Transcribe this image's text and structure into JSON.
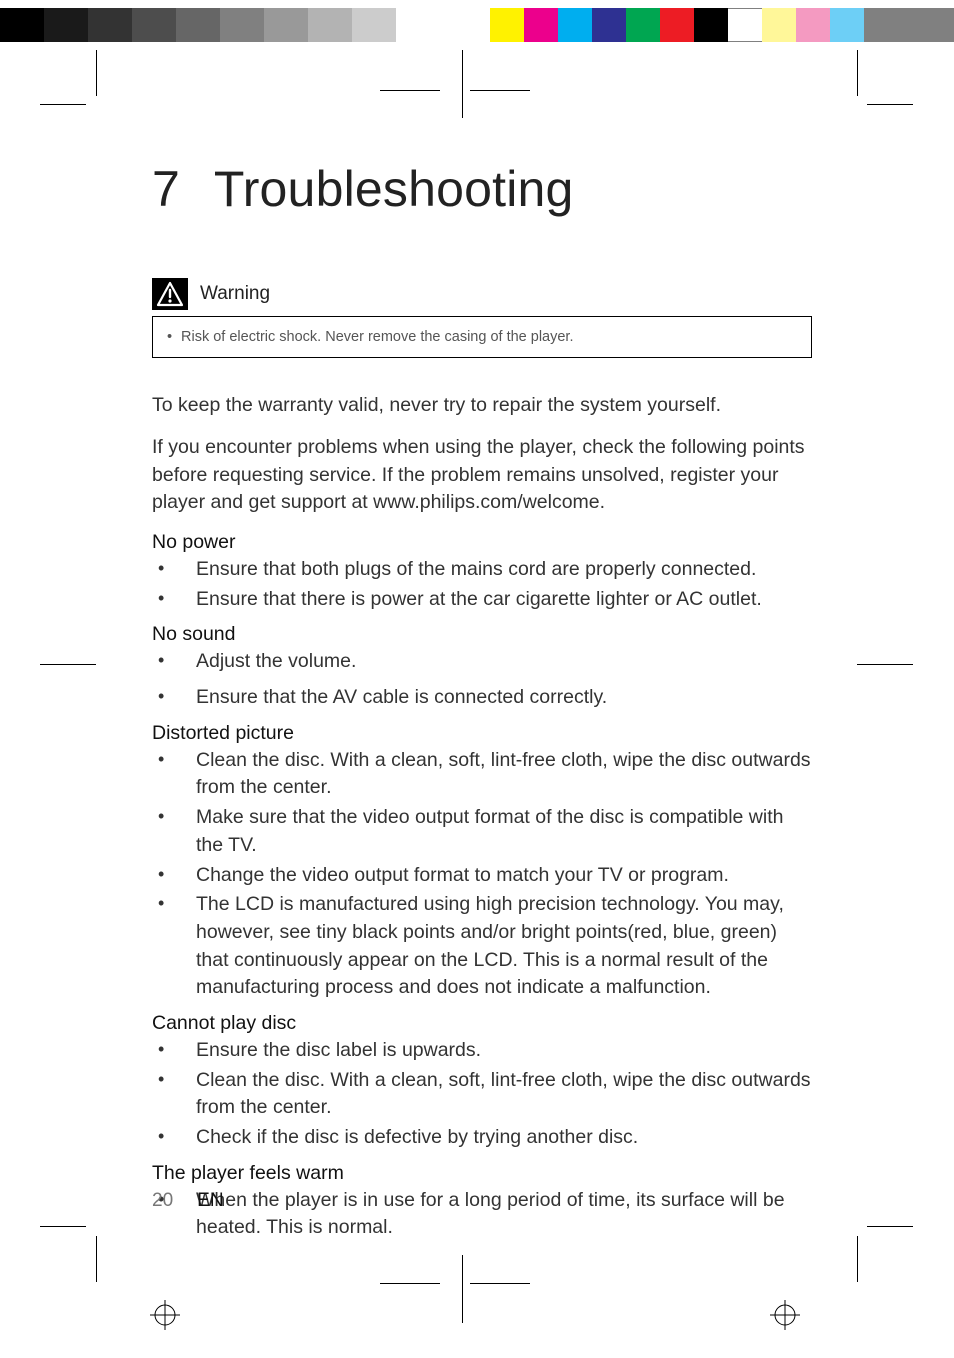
{
  "colorbar": {
    "left_gray_widths": [
      44,
      44,
      44,
      44,
      44,
      44,
      44,
      44,
      44,
      44
    ],
    "left_gray_colors": [
      "#000000",
      "#1a1a1a",
      "#333333",
      "#4d4d4d",
      "#666666",
      "#808080",
      "#999999",
      "#b3b3b3",
      "#cccccc",
      "#e6e6e6"
    ],
    "right_colors": [
      "#fff200",
      "#ec008c",
      "#00aeef",
      "#2e3192",
      "#00a651",
      "#ed1c24",
      "#000000",
      "#ffffff",
      "#fff799",
      "#f49ac1",
      "#6dcff6"
    ],
    "right_width": 34,
    "tail_color": "#808080",
    "tail_width": 90
  },
  "chapter": {
    "number": "7",
    "title": "Troubleshooting"
  },
  "warning": {
    "label": "Warning",
    "items": [
      "Risk of electric shock. Never remove the casing of the player."
    ]
  },
  "intro": [
    "To keep the warranty valid, never try to repair the system yourself.",
    "If you encounter problems when using the player, check the following points before requesting service. If the problem remains unsolved, register your player and get support at www.philips.com/welcome."
  ],
  "sections": [
    {
      "head": "No power",
      "items": [
        "Ensure that both plugs of the mains cord are properly connected.",
        "Ensure that there is power at the car cigarette lighter or AC outlet."
      ]
    },
    {
      "head": "No sound",
      "items": [
        "Adjust the volume.",
        "Ensure that the AV cable is connected correctly."
      ]
    },
    {
      "head": "Distorted picture",
      "items": [
        "Clean the disc. With a clean, soft, lint-free cloth, wipe the disc outwards from the center.",
        "Make sure that the video output format of the disc is compatible with the TV.",
        "Change the video output format to match your TV or program.",
        "The LCD is manufactured using high precision technology. You may, however, see tiny black points and/or bright points(red, blue, green) that continuously appear on the LCD. This is a normal result of the manufacturing process and does not indicate a malfunction."
      ]
    },
    {
      "head": "Cannot play disc",
      "items": [
        "Ensure the disc label is upwards.",
        "Clean the disc. With a clean, soft, lint-free cloth, wipe the disc outwards from the center.",
        "Check if the disc is defective by trying another disc."
      ]
    },
    {
      "head": "The player feels warm",
      "items": [
        "When the player is in use for a long period of time, its surface will be heated. This is normal."
      ]
    }
  ],
  "footer": {
    "page": "20",
    "lang": "EN"
  }
}
